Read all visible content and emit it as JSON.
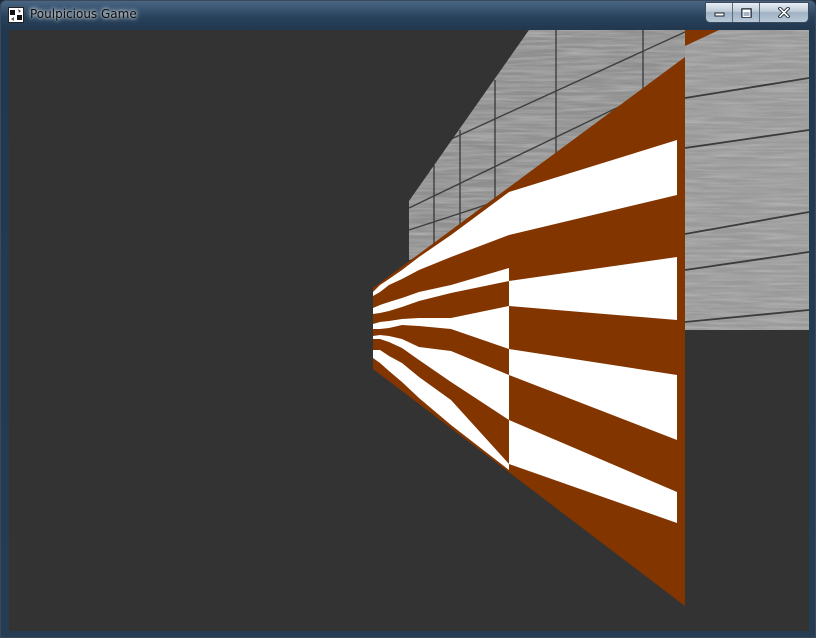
{
  "window": {
    "title": "Poulpicious Game",
    "icon": "app-icon"
  },
  "caption_buttons": {
    "minimize": "minimize-icon",
    "maximize": "maximize-icon",
    "close": "close-icon"
  },
  "scene": {
    "background_color": "#333333",
    "checker_colors": [
      "#833500",
      "#ffffff"
    ],
    "stone_wall_color": "#8e8e8e"
  }
}
